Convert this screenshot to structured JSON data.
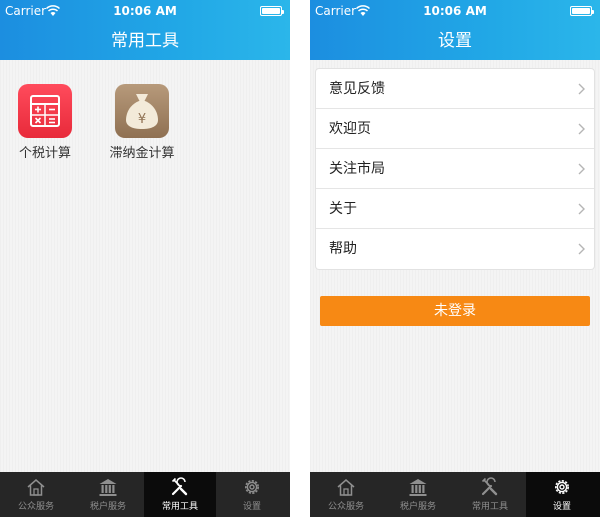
{
  "status_bar": {
    "carrier": "Carrier",
    "time": "10:06 AM"
  },
  "left_screen": {
    "title": "常用工具",
    "tools": [
      {
        "label": "个税计算",
        "icon": "calculator-icon",
        "color": "#f0313f"
      },
      {
        "label": "滞纳金计算",
        "icon": "money-bag-icon",
        "color": "#a58767",
        "symbol": "¥"
      }
    ]
  },
  "right_screen": {
    "title": "设置",
    "menu": [
      {
        "label": "意见反馈"
      },
      {
        "label": "欢迎页"
      },
      {
        "label": "关注市局"
      },
      {
        "label": "关于"
      },
      {
        "label": "帮助"
      }
    ],
    "login_button": "未登录"
  },
  "tabbar": {
    "tabs": [
      {
        "label": "公众服务",
        "icon": "home-icon"
      },
      {
        "label": "税户服务",
        "icon": "bank-icon"
      },
      {
        "label": "常用工具",
        "icon": "tools-icon"
      },
      {
        "label": "设置",
        "icon": "gear-icon"
      }
    ],
    "left_active": 2,
    "right_active": 3
  },
  "colors": {
    "header_blue": "#1c8ee0",
    "login_orange": "#f78914",
    "tabbar_bg": "#262626"
  }
}
